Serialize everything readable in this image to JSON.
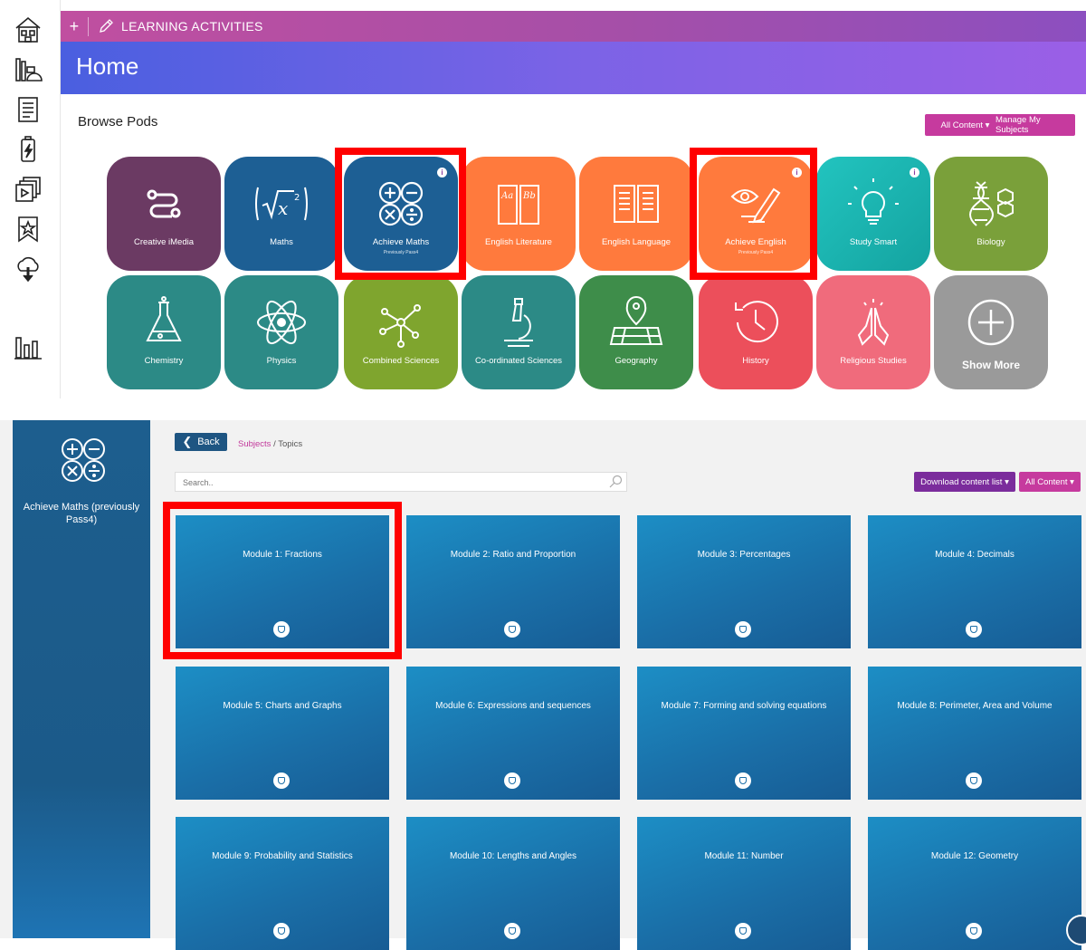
{
  "top": {
    "plus": "+",
    "section_label": "LEARNING ACTIVITIES",
    "page_title": "Home",
    "browse_title": "Browse Pods",
    "all_content_btn": "All Content ▾",
    "manage_btn": "Manage My Subjects"
  },
  "rail_icons": [
    "home-icon",
    "library-icon",
    "document-icon",
    "battery-icon",
    "slides-icon",
    "bookmark-star-icon",
    "cloud-download-icon",
    "stats-icon"
  ],
  "pods_row1": [
    {
      "label": "Creative iMedia",
      "sub": "",
      "color": "#6b3a63",
      "info": false
    },
    {
      "label": "Maths",
      "sub": "",
      "color": "#1d5f94",
      "info": false
    },
    {
      "label": "Achieve Maths",
      "sub": "Previously Pass4",
      "color": "#1d5f94",
      "info": true
    },
    {
      "label": "English Literature",
      "sub": "",
      "color": "#ff7a3d",
      "info": false
    },
    {
      "label": "English Language",
      "sub": "",
      "color": "#ff7a3d",
      "info": false
    },
    {
      "label": "Achieve English",
      "sub": "Previously Pass4",
      "color": "#ff7a3d",
      "info": true
    },
    {
      "label": "Study Smart",
      "sub": "",
      "color": "#1fb7b3",
      "info": true
    },
    {
      "label": "Biology",
      "sub": "",
      "color": "#7aa03a",
      "info": false
    }
  ],
  "pods_row2": [
    {
      "label": "Chemistry",
      "color": "#2c8a86"
    },
    {
      "label": "Physics",
      "color": "#2c8a86"
    },
    {
      "label": "Combined Sciences",
      "color": "#7fa52e"
    },
    {
      "label": "Co-ordinated Sciences",
      "color": "#2c8a86"
    },
    {
      "label": "Geography",
      "color": "#3e8d4a"
    },
    {
      "label": "History",
      "color": "#ec4f5b"
    },
    {
      "label": "Religious Studies",
      "color": "#f06b7c"
    },
    {
      "label": "Show More",
      "color": "#9a9a9a"
    }
  ],
  "bottom": {
    "panel_title": "Achieve Maths (previously Pass4)",
    "back_label": "Back",
    "crumb_link": "Subjects",
    "crumb_sep": " / ",
    "crumb_current": "Topics",
    "search_placeholder": "Search..",
    "download_btn": "Download content list ▾",
    "all_content_btn": "All Content ▾"
  },
  "modules": [
    "Module 1: Fractions",
    "Module 2: Ratio and Proportion",
    "Module 3: Percentages",
    "Module 4: Decimals",
    "Module 5: Charts and Graphs",
    "Module 6: Expressions and sequences",
    "Module 7: Forming and solving equations",
    "Module 8: Perimeter, Area and Volume",
    "Module 9: Probability and Statistics",
    "Module 10: Lengths and Angles",
    "Module 11: Number",
    "Module 12: Geometry"
  ],
  "colors": {
    "highlight": "#ff0000",
    "pink_button": "#c63a9e",
    "purple_button": "#7b2c9c",
    "card_blue": "#1a6ea7"
  }
}
